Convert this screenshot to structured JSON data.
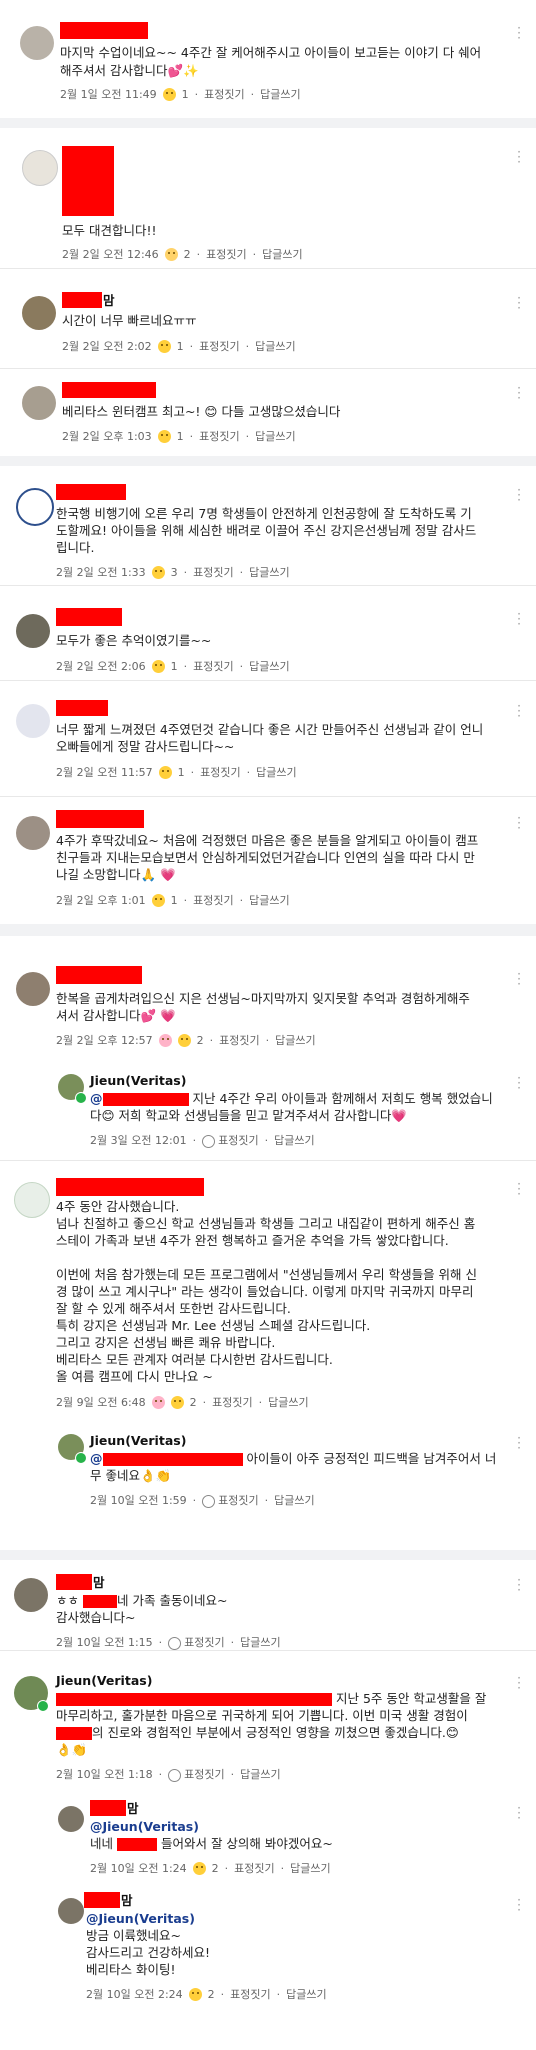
{
  "reactions": {
    "face_emoji": "😊",
    "sad_emoji": "😢",
    "heart_emoji": "💕",
    "sparkle": "✨",
    "pray": "🙏",
    "heart2": "💗",
    "hand": "👌",
    "applause": "👏",
    "react_label": "표정짓기",
    "reply_label": "답글쓰기",
    "more_icon": "more-vertical-icon"
  },
  "comments": [
    {
      "text1": "마지막 수업이네요~~ 4주간 잘 케어해주시고 아이들이 보고듣는 이야기 다 쉐어",
      "text2": "해주셔서 감사합니다",
      "time": "2월 1일 오전 11:49",
      "count": "1"
    },
    {
      "text1": "모두 대견합니다!!",
      "time": "2월 2일 오전 12:46",
      "count": "2"
    },
    {
      "name_suffix": "맘",
      "text1": "시간이 너무 빠르네요ㅠㅠ",
      "time": "2월 2일 오전 2:02",
      "count": "1"
    },
    {
      "text1": "베리타스 윈터캠프 최고~!",
      "text1b": "다들 고생많으셨습니다",
      "time": "2월 2일 오후 1:03",
      "count": "1"
    },
    {
      "text1": "한국행 비행기에 오른 우리 7명 학생들이 안전하게 인천공항에 잘 도착하도록 기",
      "text2": "도할께요! 아이들을 위해 세심한 배려로 이끌어 주신 강지은선생님께 정말 감사드",
      "text3": "립니다.",
      "time": "2월 2일 오전 1:33",
      "count": "3"
    },
    {
      "text1": "모두가 좋은 추억이였기를~~",
      "time": "2월 2일 오전 2:06",
      "count": "1"
    },
    {
      "text1": "너무 짧게 느껴졌던 4주였던것 같습니다 좋은 시간 만들어주신 선생님과 같이 언니",
      "text2": "오빠들에게 정말 감사드립니다~~",
      "time": "2월 2일 오전 11:57",
      "count": "1"
    },
    {
      "text1": "4주가 후딱갔네요~ 처음에 걱정했던 마음은 좋은 분들을 알게되고 아이들이 캠프",
      "text2": "친구들과 지내는모습보면서 안심하게되었던거같습니다 인연의 실을 따라 다시 만",
      "text3": "나길 소망합니다",
      "time": "2월 2일 오후 1:01",
      "count": "1"
    },
    {
      "text1": "한복을 곱게차려입으신 지은 선생님~마지막까지 잊지못할 추억과 경험하게해주",
      "text2": "셔서 감사합니다",
      "time": "2월 2일 오후 12:57",
      "count": "2"
    },
    {
      "name": "Jieun(Veritas)",
      "text1b": "지난 4주간 우리 아이들과 함께해서 저희도 행복 했었습니",
      "text2": "다",
      "text2b": "저희 학교와 선생님들을 믿고 맡겨주셔서 감사합니다",
      "time": "2월 3일 오전 12:01"
    },
    {
      "lines": [
        "4주 동안 감사했습니다.",
        "넘나 친절하고 좋으신 학교 선생님들과 학생들 그리고 내집같이 편하게 해주신 홈",
        "스테이 가족과 보낸 4주가 완전 행복하고 즐거운 추억을 가득 쌓았다합니다.",
        "",
        "이번에 처음 참가했는데 모든 프로그램에서 \"선생님들께서 우리 학생들을 위해 신",
        "경 많이 쓰고 계시구나\" 라는 생각이 들었습니다. 이렇게 마지막 귀국까지 마무리",
        "잘 할 수 있게 해주셔서 또한번 감사드립니다.",
        "특히 강지은 선생님과 Mr. Lee 선생님 스페셜 감사드립니다.",
        "그리고 강지은 선생님 빠른 쾌유 바랍니다.",
        "베리타스 모든 관계자 여러분 다시한번 감사드립니다.",
        "올 여름 캠프에  다시 만나요 ~"
      ],
      "time": "2월 9일 오전 6:48",
      "count": "2"
    },
    {
      "name": "Jieun(Veritas)",
      "text1b": "아이들이 아주 긍정적인 피드백을 남겨주어서 너",
      "text2": "무 좋네요",
      "time": "2월 10일 오전 1:59"
    },
    {
      "name_suffix": "맘",
      "text1a": "ㅎㅎ",
      "text1b": "네 가족 출동이네요~",
      "text2": "감사했습니다~",
      "time": "2월 10일 오전 1:15"
    },
    {
      "name": "Jieun(Veritas)",
      "text1b": "지난 5주 동안 학교생활을 잘",
      "text2": "마무리하고, 홀가분한 마음으로 귀국하게 되어 기쁩니다. 이번 미국 생활 경험이",
      "text3b": "의 진로와 경험적인 부분에서 긍정적인 영향을 끼쳤으면 좋겠습니다.",
      "time": "2월 10일 오전 1:18"
    },
    {
      "name_suffix": "맘",
      "mention": "@Jieun(Veritas)",
      "text1a": "네네",
      "text1b": "들어와서 잘 상의해 봐야겠어요~",
      "time": "2월 10일 오전 1:24",
      "count": "2"
    },
    {
      "name_suffix": "맘",
      "mention": "@Jieun(Veritas)",
      "lines": [
        "방금 이륙했네요~",
        "감사드리고 건강하세요!",
        "베리타스 화이팅!"
      ],
      "time": "2월 10일 오전 2:24",
      "count": "2"
    }
  ]
}
